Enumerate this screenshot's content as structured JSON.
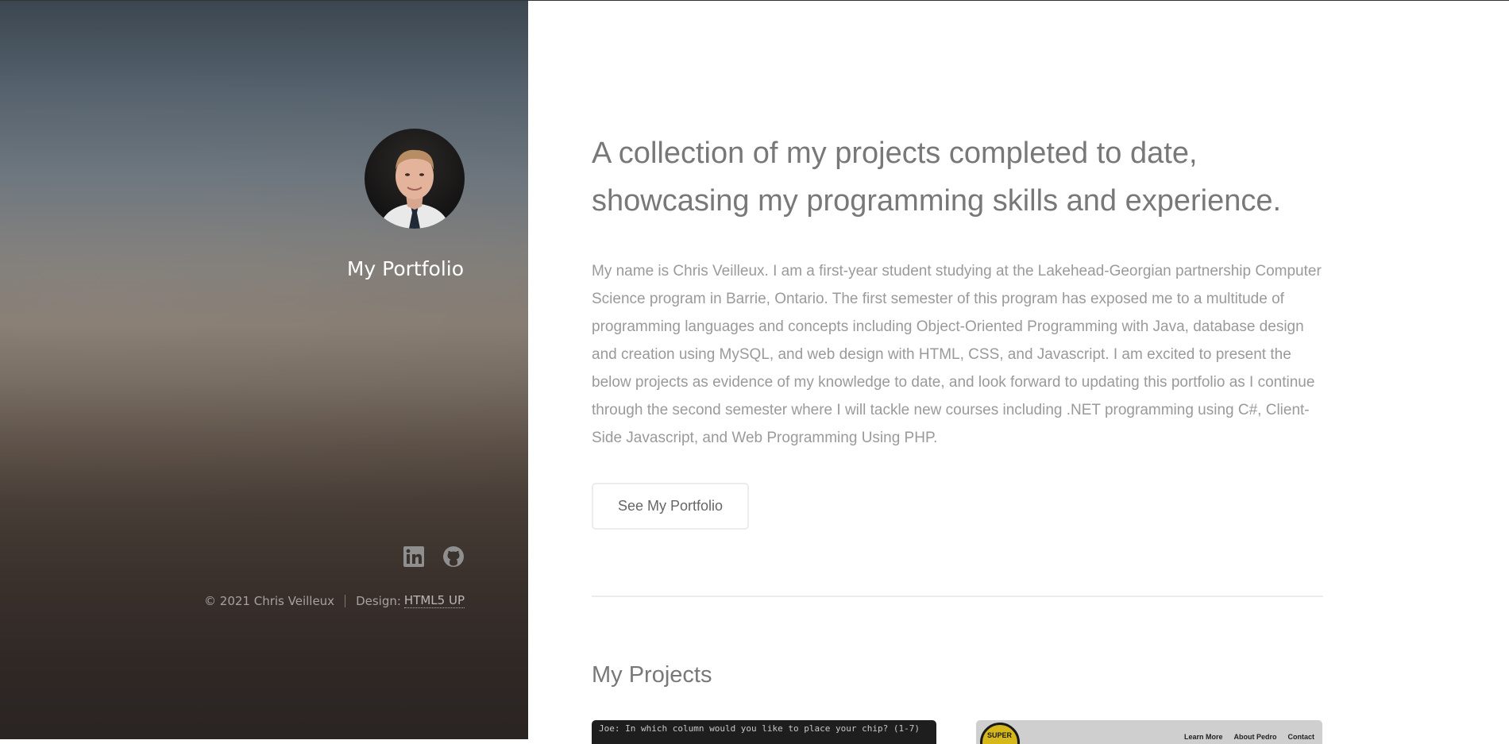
{
  "sidebar": {
    "title": "My Portfolio",
    "avatar_alt": "Chris Veilleux",
    "social": [
      {
        "icon": "linkedin-icon",
        "label": "LinkedIn"
      },
      {
        "icon": "github-icon",
        "label": "GitHub"
      }
    ],
    "footer": {
      "copyright": "© 2021 Chris Veilleux",
      "design_label": "Design:",
      "design_link": "HTML5 UP"
    }
  },
  "main": {
    "headline": "A collection of my projects completed to date, showcasing my programming skills and experience.",
    "intro": "My name is Chris Veilleux. I am a first-year student studying at the Lakehead-Georgian partnership Computer Science program in Barrie, Ontario. The first semester of this program has exposed me to a multitude of programming languages and concepts including Object-Oriented Programming with Java, database design and creation using MySQL, and web design with HTML, CSS, and Javascript. I am excited to present the below projects as evidence of my knowledge to date, and look forward to updating this portfolio as I continue through the second semester where I will tackle new courses including .NET programming using C#, Client-Side Javascript, and Web Programming Using PHP.",
    "cta_label": "See My Portfolio",
    "projects_heading": "My Projects",
    "projects": [
      {
        "preview_text": "Joe: In which column would you like to place your chip? (1-7)"
      },
      {
        "logo_text": "SUPER",
        "nav": [
          "Learn More",
          "About Pedro",
          "Contact"
        ]
      }
    ]
  },
  "colors": {
    "heading": "#787878",
    "body_text": "#9a9a9a",
    "sidebar_text": "#ffffff"
  }
}
